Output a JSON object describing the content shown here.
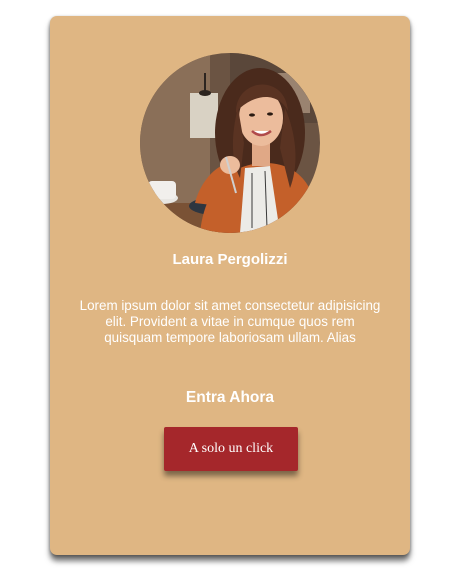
{
  "card": {
    "name": "Laura Pergolizzi",
    "description": "Lorem ipsum dolor sit amet consectetur adipisicing elit. Provident a vitae in cumque quos rem quisquam tempore laboriosam ullam. Alias",
    "cta_title": "Entra Ahora",
    "cta_button_label": "A solo un click"
  },
  "colors": {
    "card_background": "#dfb683",
    "button_background": "#a5272b",
    "text": "#ffffff"
  }
}
